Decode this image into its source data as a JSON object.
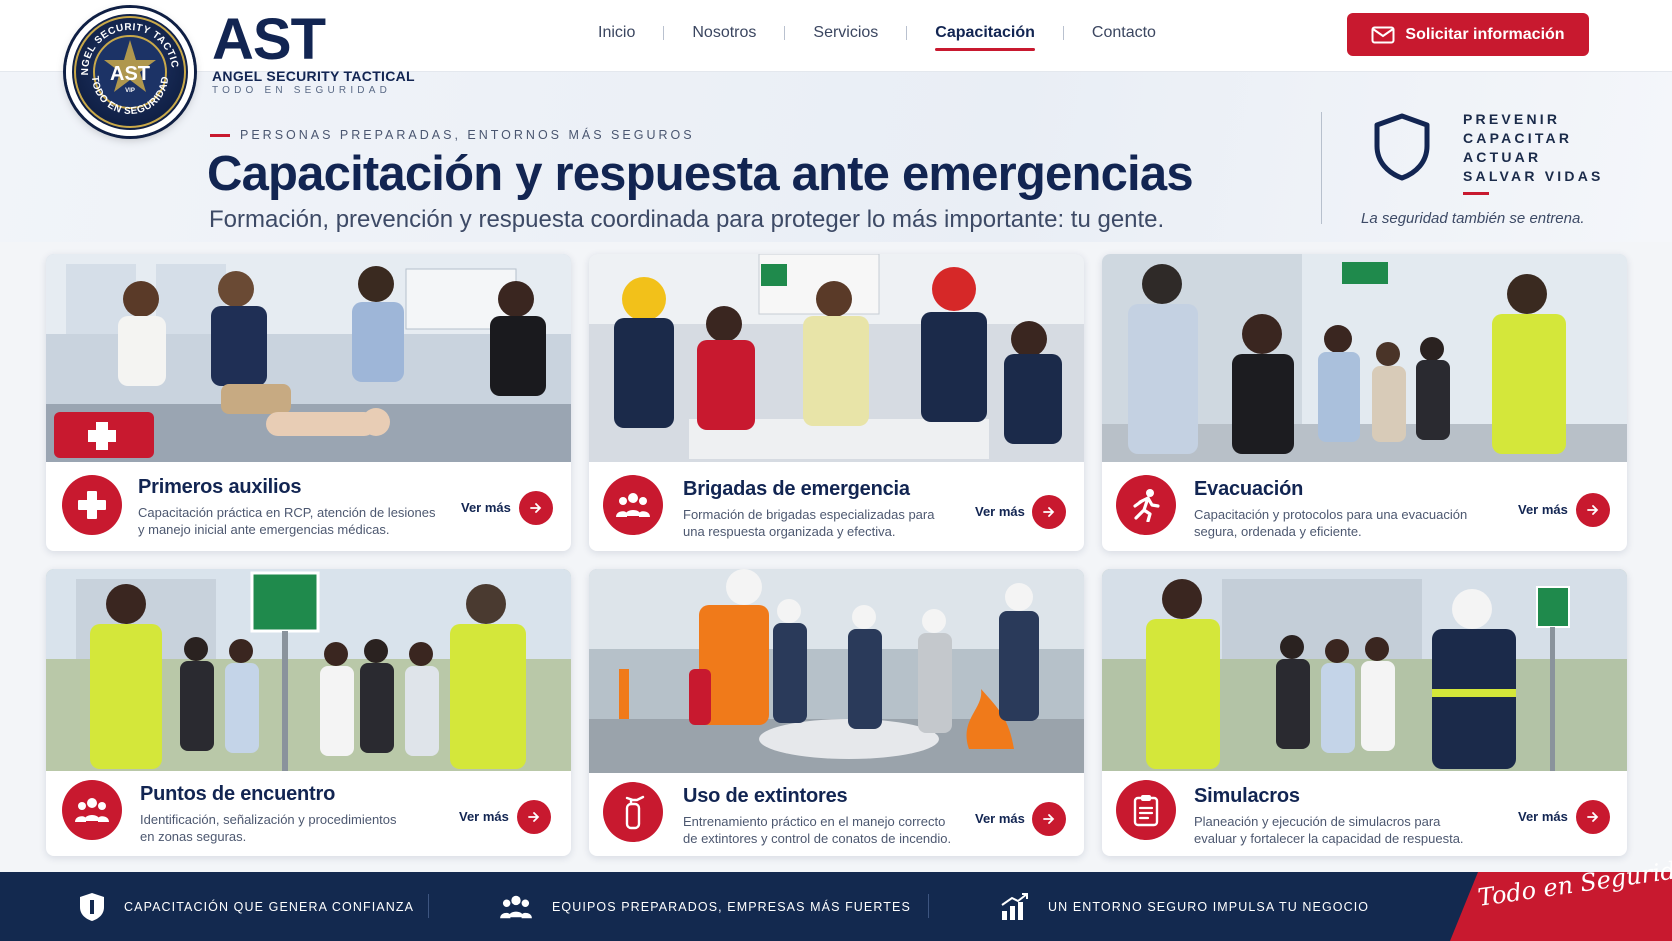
{
  "brand": {
    "badge_top": "ANGEL SECURITY TACTICAL",
    "badge_center": "AST",
    "badge_bottom": "TODO EN SEGURIDAD",
    "badge_small": "VIP",
    "logo": "AST",
    "name": "ANGEL SECURITY TACTICAL",
    "tagline": "TODO EN SEGURIDAD"
  },
  "nav": {
    "items": [
      {
        "label": "Inicio",
        "active": false
      },
      {
        "label": "Nosotros",
        "active": false
      },
      {
        "label": "Servicios",
        "active": false
      },
      {
        "label": "Capacitación",
        "active": true
      },
      {
        "label": "Contacto",
        "active": false
      }
    ],
    "cta_label": "Solicitar información",
    "cta_icon": "mail-icon"
  },
  "hero": {
    "eyebrow": "PERSONAS PREPARADAS, ENTORNOS MÁS SEGUROS",
    "title": "Capacitación y respuesta ante emergencias",
    "subtitle": "Formación, prevención y respuesta coordinada para proteger lo más importante: tu gente.",
    "pillars": [
      "PREVENIR",
      "CAPACITAR",
      "ACTUAR",
      "SALVAR VIDAS"
    ],
    "tagline": "La seguridad también se entrena."
  },
  "cards": [
    {
      "title": "Primeros auxilios",
      "description": "Capacitación práctica en RCP, atención de lesiones y manejo inicial ante emergencias médicas.",
      "more": "Ver más",
      "icon": "first-aid-cross-icon"
    },
    {
      "title": "Brigadas de emergencia",
      "description": "Formación de brigadas especializadas para una respuesta organizada y efectiva.",
      "more": "Ver más",
      "icon": "team-icon"
    },
    {
      "title": "Evacuación",
      "description": "Capacitación y protocolos para una evacuación segura, ordenada y eficiente.",
      "more": "Ver más",
      "icon": "running-person-icon"
    },
    {
      "title": "Puntos de encuentro",
      "description": "Identificación, señalización y procedimientos en zonas seguras.",
      "more": "Ver más",
      "icon": "group-icon"
    },
    {
      "title": "Uso de extintores",
      "description": "Entrenamiento práctico en el manejo correcto de extintores y control de conatos de incendio.",
      "more": "Ver más",
      "icon": "fire-extinguisher-icon"
    },
    {
      "title": "Simulacros",
      "description": "Planeación y ejecución de simulacros para evaluar y fortalecer la capacidad de respuesta.",
      "more": "Ver más",
      "icon": "clipboard-icon"
    }
  ],
  "footer": {
    "items": [
      {
        "label": "CAPACITACIÓN QUE GENERA CONFIANZA",
        "icon": "shield-icon"
      },
      {
        "label": "EQUIPOS PREPARADOS, EMPRESAS MÁS FUERTES",
        "icon": "team-icon"
      },
      {
        "label": "UN ENTORNO SEGURO IMPULSA TU NEGOCIO",
        "icon": "growth-chart-icon"
      }
    ],
    "signature": "Todo en Seguridad"
  },
  "colors": {
    "accent": "#c8192f",
    "navy": "#122552",
    "footer": "#13294f"
  }
}
